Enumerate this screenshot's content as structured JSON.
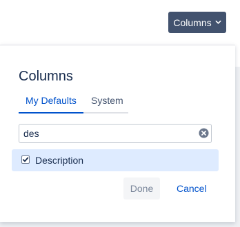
{
  "toolbar": {
    "columns_button_label": "Columns",
    "columns_button_icon": "chevron-down-icon"
  },
  "popup": {
    "title": "Columns",
    "tabs": [
      {
        "label": "My Defaults",
        "active": true
      },
      {
        "label": "System",
        "active": false
      }
    ],
    "search": {
      "value": "des",
      "clear_icon": "clear-circle-icon"
    },
    "results": [
      {
        "label": "Description",
        "checked": true
      }
    ],
    "done_label": "Done",
    "cancel_label": "Cancel"
  },
  "colors": {
    "button_bg": "#42526e",
    "accent": "#0052cc",
    "row_highlight": "#deebff",
    "heading": "#172b4d"
  }
}
